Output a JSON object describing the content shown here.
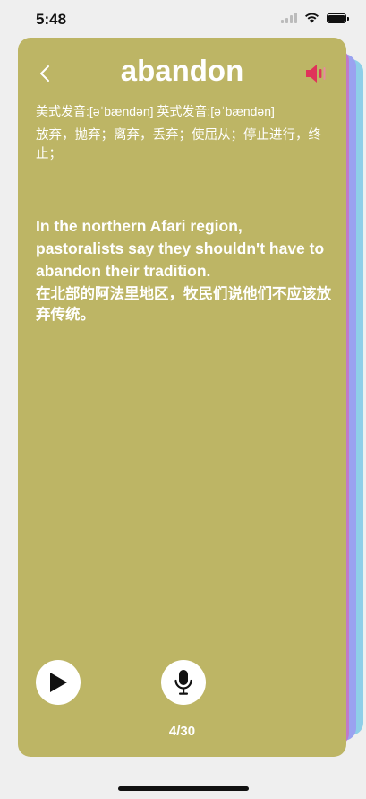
{
  "status_bar": {
    "time": "5:48"
  },
  "card": {
    "word": "abandon",
    "phonetics": "美式发音:[əˈbændən] 英式发音:[əˈbændən]",
    "definition": "放弃，抛弃；离弃，丢弃；使屈从；停止进行，终止；",
    "example_en": "In the northern Afari region, pastoralists say they shouldn't have to abandon their tradition.",
    "example_zh": "在北部的阿法里地区，牧民们说他们不应该放弃传统。",
    "progress": "4/30"
  },
  "colors": {
    "card_background": "#bdb565",
    "speaker_icon": "#e0325a",
    "stack_purple": "#c07ac9",
    "stack_blue": "#9aa2f0",
    "stack_cyan": "#8ecfe8"
  },
  "icons": {
    "back": "chevron-left-icon",
    "speaker": "speaker-icon",
    "play": "play-icon",
    "mic": "microphone-icon"
  }
}
